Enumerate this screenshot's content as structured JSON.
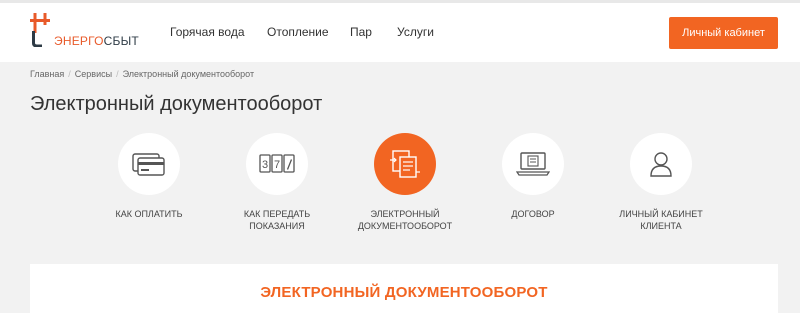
{
  "logo": {
    "text_accent": "ЭНЕРГО",
    "text_main": "СБЫТ"
  },
  "nav": [
    "Горячая вода",
    "Отопление",
    "Пар",
    "Услуги"
  ],
  "header": {
    "cabinet_label": "Личный кабинет"
  },
  "breadcrumb": [
    "Главная",
    "Сервисы",
    "Электронный документооборот"
  ],
  "page": {
    "title": "Электронный документооборот"
  },
  "services": [
    {
      "line1": "КАК ОПЛАТИТЬ",
      "line2": "",
      "icon": "credit-card-icon"
    },
    {
      "line1": "КАК ПЕРЕДАТЬ",
      "line2": "ПОКАЗАНИЯ",
      "icon": "meter-icon",
      "digits": [
        "3",
        "7"
      ]
    },
    {
      "line1": "ЭЛЕКТРОННЫЙ",
      "line2": "ДОКУМЕНТООБОРОТ",
      "icon": "documents-exchange-icon",
      "active": true
    },
    {
      "line1": "ДОГОВОР",
      "line2": "",
      "icon": "laptop-document-icon"
    },
    {
      "line1": "ЛИЧНЫЙ КАБИНЕТ",
      "line2": "КЛИЕНТА",
      "icon": "user-icon"
    }
  ],
  "section": {
    "title": "ЭЛЕКТРОННЫЙ ДОКУМЕНТООБОРОТ"
  },
  "colors": {
    "accent": "#f26522",
    "logo_dark": "#2e3b46",
    "background": "#f2f2f2"
  }
}
